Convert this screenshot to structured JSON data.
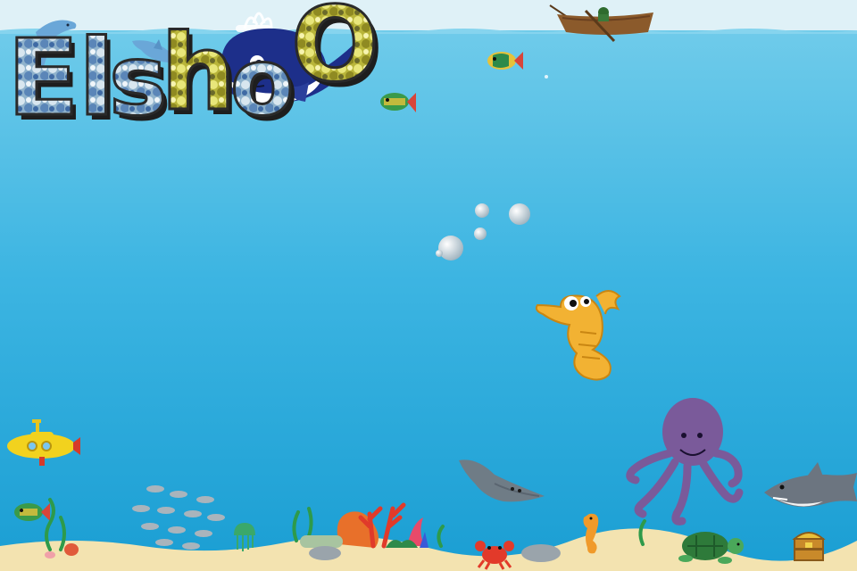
{
  "game": {
    "title": "ElshoO"
  },
  "colors": {
    "sky": "#dff1f7",
    "water_top": "#6fcbea",
    "water_bottom": "#1a9ed3",
    "sand": "#f3e3b0",
    "whale": "#1d2f8a",
    "octopus": "#7a5a9a",
    "seahorse": "#f2b233",
    "letter_fill": "#9fb7c8",
    "letter_yellow": "#c9c640",
    "letter_edge": "#2a2a2a"
  },
  "sprites": [
    "dolphin-icon",
    "whale-icon",
    "fishing-boat-icon",
    "tropical-fish-icon",
    "submarine-icon",
    "stingray-icon",
    "octopus-icon",
    "shark-icon",
    "seahorse-icon",
    "crab-icon",
    "sea-turtle-icon",
    "treasure-chest-icon",
    "jellyfish-icon",
    "fish-school-icon",
    "coral-icon",
    "seaweed-icon"
  ]
}
